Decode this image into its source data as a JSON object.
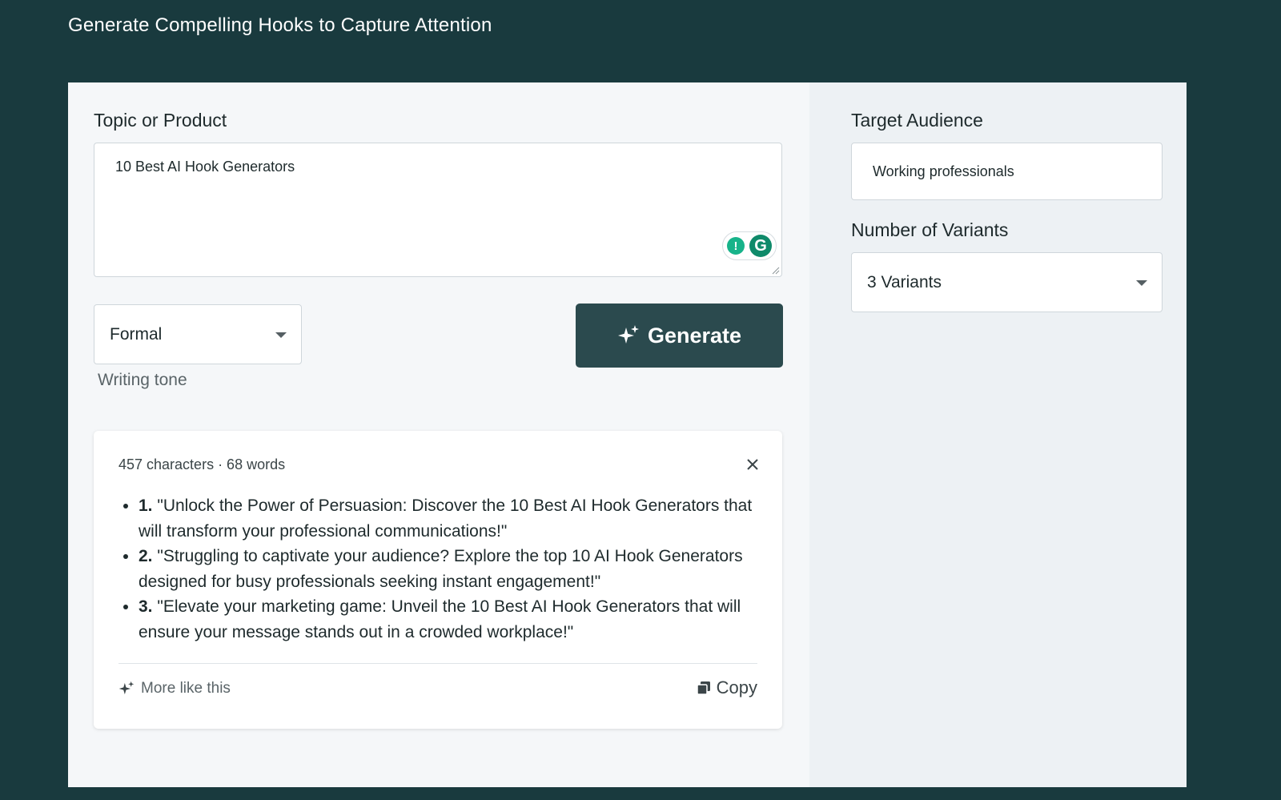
{
  "page": {
    "title": "Generate Compelling Hooks to Capture Attention"
  },
  "form": {
    "topic_label": "Topic or Product",
    "topic_value": "10 Best AI Hook Generators",
    "tone_value": "Formal",
    "tone_helper": "Writing tone",
    "generate_label": "Generate",
    "audience_label": "Target Audience",
    "audience_value": "Working professionals",
    "variants_label": "Number of Variants",
    "variants_value": "3 Variants"
  },
  "result": {
    "meta": "457 characters · 68 words",
    "hooks": [
      {
        "num": "1.",
        "text": "\"Unlock the Power of Persuasion: Discover the 10 Best AI Hook Generators that will transform your professional communications!\""
      },
      {
        "num": "2.",
        "text": "\"Struggling to captivate your audience? Explore the top 10 AI Hook Generators designed for busy professionals seeking instant engagement!\""
      },
      {
        "num": "3.",
        "text": "\"Elevate your marketing game: Unveil the 10 Best AI Hook Generators that will ensure your message stands out in a crowded workplace!\""
      }
    ],
    "more_label": "More like this",
    "copy_label": "Copy"
  },
  "icons": {
    "sparkle": "sparkle-icon",
    "close": "close-icon",
    "copy": "copy-icon",
    "grammarly": "grammarly-icon",
    "bulb": "lightbulb-icon",
    "dropdown": "chevron-down-icon"
  },
  "colors": {
    "background": "#193a3e",
    "panel": "#f5f7f9",
    "right_panel": "#edf1f4",
    "button": "#2b4a4e",
    "grammarly": "#0f8a6a"
  }
}
